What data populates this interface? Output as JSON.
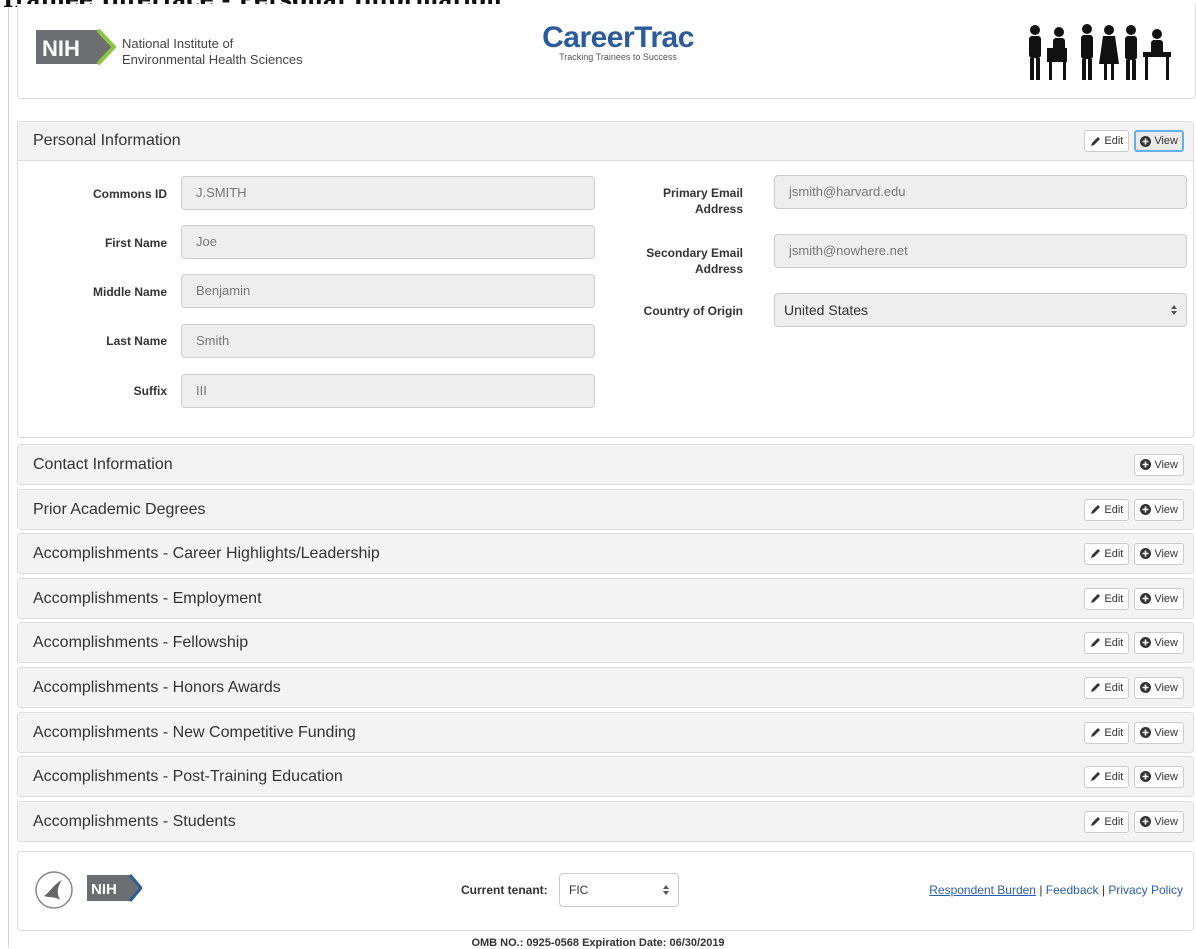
{
  "page_heading": "Trainee Interface - Personal Information",
  "header": {
    "logo_text": "NIH",
    "org_line1": "National Institute of",
    "org_line2": "Environmental Health Sciences",
    "app_title": "CareerTrac",
    "app_tagline": "Tracking Trainees to Success"
  },
  "buttons": {
    "edit": "Edit",
    "view": "View"
  },
  "personal": {
    "title": "Personal Information",
    "commons_id": {
      "label": "Commons ID",
      "value": "J.SMITH"
    },
    "first_name": {
      "label": "First Name",
      "value": "Joe"
    },
    "middle_name": {
      "label": "Middle Name",
      "value": "Benjamin"
    },
    "last_name": {
      "label": "Last Name",
      "value": "Smith"
    },
    "suffix": {
      "label": "Suffix",
      "value": "III"
    },
    "primary_email": {
      "label_line1": "Primary Email",
      "label_line2": "Address",
      "value": "jsmith@harvard.edu"
    },
    "secondary_email": {
      "label_line1": "Secondary Email",
      "label_line2": "Address",
      "value": "jsmith@nowhere.net"
    },
    "country": {
      "label": "Country of Origin",
      "value": "United States"
    }
  },
  "sections": [
    {
      "title": "Contact Information",
      "edit": false
    },
    {
      "title": "Prior Academic Degrees",
      "edit": true
    },
    {
      "title": "Accomplishments - Career Highlights/Leadership",
      "edit": true
    },
    {
      "title": "Accomplishments - Employment",
      "edit": true
    },
    {
      "title": "Accomplishments - Fellowship",
      "edit": true
    },
    {
      "title": "Accomplishments - Honors Awards",
      "edit": true
    },
    {
      "title": "Accomplishments - New Competitive Funding",
      "edit": true
    },
    {
      "title": "Accomplishments - Post-Training Education",
      "edit": true
    },
    {
      "title": "Accomplishments - Students",
      "edit": true
    }
  ],
  "footer": {
    "nih_text": "NIH",
    "tenant_label": "Current tenant:",
    "tenant_value": "FIC",
    "link_burden": "Respondent Burden",
    "separator": "|",
    "link_feedback": "Feedback",
    "link_privacy": "Privacy Policy",
    "omb": "OMB NO.: 0925-0568   Expiration Date: 06/30/2019"
  },
  "colors": {
    "brand_blue": "#2b5b9a",
    "nih_gray": "#6d6e71",
    "nih_green": "#8dc63f",
    "link": "#2a5db0",
    "focus": "#66afe9"
  }
}
